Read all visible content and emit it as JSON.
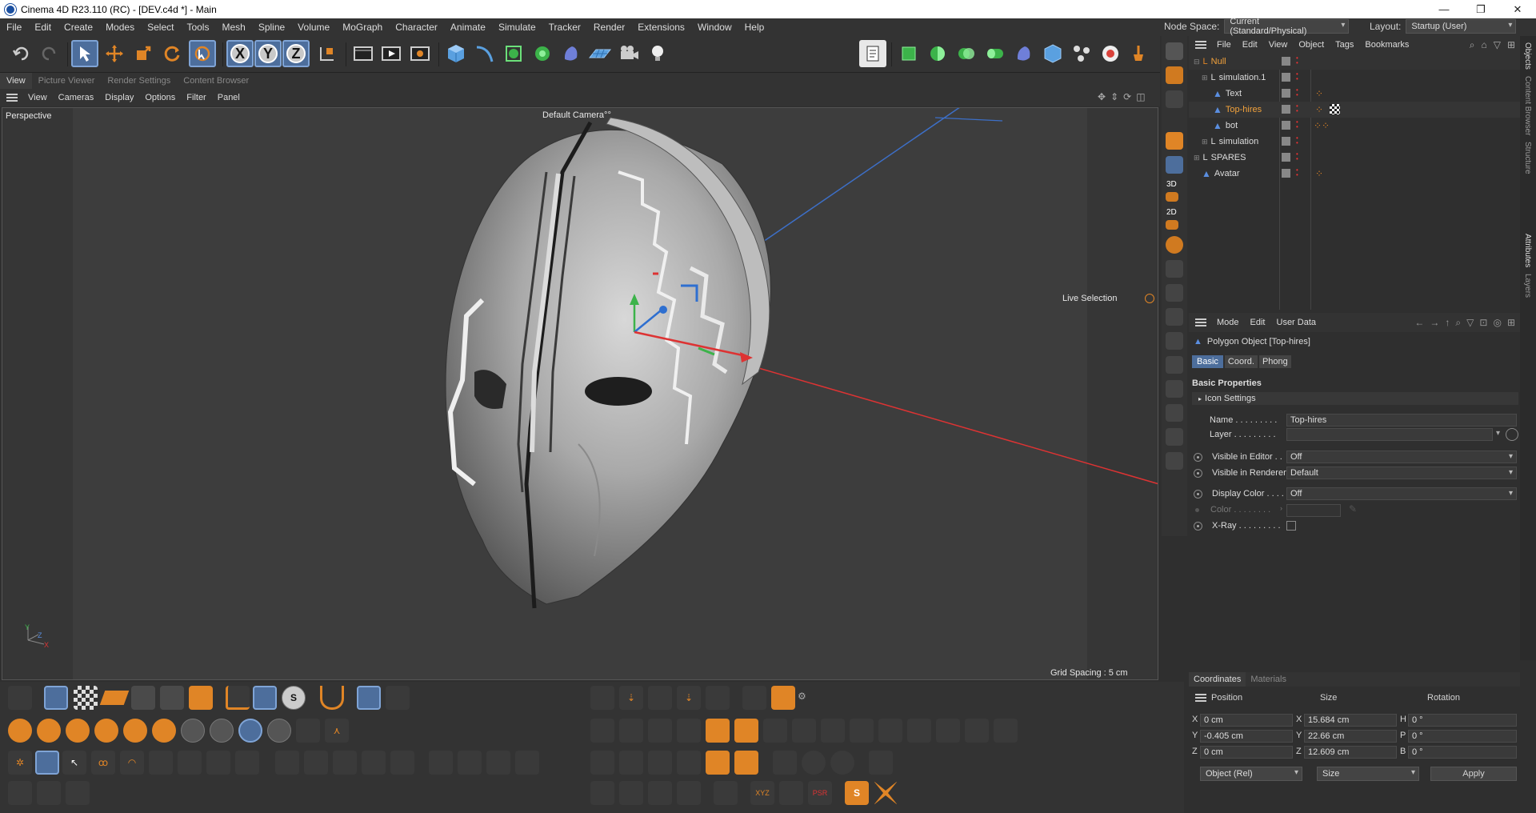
{
  "window": {
    "title": "Cinema 4D R23.110 (RC) - [DEV.c4d *] - Main",
    "minimize": "—",
    "restore": "❐",
    "close": "✕"
  },
  "menu": [
    "File",
    "Edit",
    "Create",
    "Modes",
    "Select",
    "Tools",
    "Mesh",
    "Spline",
    "Volume",
    "MoGraph",
    "Character",
    "Animate",
    "Simulate",
    "Tracker",
    "Render",
    "Extensions",
    "Window",
    "Help"
  ],
  "node_space": {
    "label": "Node Space:",
    "value": "Current (Standard/Physical)"
  },
  "layout": {
    "label": "Layout:",
    "value": "Startup (User)"
  },
  "toolbar": {
    "x_label": "X",
    "y_label": "Y",
    "z_label": "Z"
  },
  "view_tabs": [
    "View",
    "Picture Viewer",
    "Render Settings",
    "Content Browser"
  ],
  "view_menu": [
    "View",
    "Cameras",
    "Display",
    "Options",
    "Filter",
    "Panel"
  ],
  "viewport": {
    "projection": "Perspective",
    "camera": "Default Camera",
    "camera_suffix": "°°",
    "tool": "Live Selection",
    "grid_spacing": "Grid Spacing : 5 cm",
    "axis_y": "Y",
    "axis_z": "Z",
    "axis_x": "X"
  },
  "strip_labels": {
    "threed": "3D",
    "twod": "2D"
  },
  "object_manager": {
    "menu": [
      "File",
      "Edit",
      "View",
      "Object",
      "Tags",
      "Bookmarks"
    ],
    "objects": [
      {
        "name": "Null",
        "color": "#f2a23c"
      },
      {
        "name": "simulation.1",
        "color": "#dddddd"
      },
      {
        "name": "Text",
        "color": "#dddddd"
      },
      {
        "name": "Top-hires",
        "color": "#f2a23c"
      },
      {
        "name": "bot",
        "color": "#dddddd"
      },
      {
        "name": "simulation",
        "color": "#dddddd"
      },
      {
        "name": "SPARES",
        "color": "#dddddd"
      },
      {
        "name": "Avatar",
        "color": "#dddddd"
      }
    ]
  },
  "side_tabs": {
    "top": [
      "Objects",
      "Content Browser",
      "Structure"
    ],
    "mid": [
      "Attributes",
      "Layers"
    ]
  },
  "attributes": {
    "menu": [
      "Mode",
      "Edit",
      "User Data"
    ],
    "object_title": "Polygon Object [Top-hires]",
    "tabs": [
      "Basic",
      "Coord.",
      "Phong"
    ],
    "section": "Basic Properties",
    "icon_settings": "Icon Settings",
    "name_label": "Name . . . . . . . . .",
    "name_value": "Top-hires",
    "layer_label": "Layer . . . . . . . . .",
    "visible_editor_label": "Visible in Editor . .",
    "visible_editor_value": "Off",
    "visible_renderer_label": "Visible in Renderer",
    "visible_renderer_value": "Default",
    "display_color_label": "Display Color . . . .",
    "display_color_value": "Off",
    "color_label": "Color . . . . . . . .",
    "xray_label": "X-Ray . . . . . . . . ."
  },
  "coordinates": {
    "tabs": [
      "Coordinates",
      "Materials"
    ],
    "headers": [
      "Position",
      "Size",
      "Rotation"
    ],
    "rows": [
      {
        "axis": "X",
        "pos": "0 cm",
        "size_axis": "X",
        "size": "15.684 cm",
        "rot_axis": "H",
        "rot": "0 °"
      },
      {
        "axis": "Y",
        "pos": "-0.405 cm",
        "size_axis": "Y",
        "size": "22.66 cm",
        "rot_axis": "P",
        "rot": "0 °"
      },
      {
        "axis": "Z",
        "pos": "0 cm",
        "size_axis": "Z",
        "size": "12.609 cm",
        "rot_axis": "B",
        "rot": "0 °"
      }
    ],
    "mode": "Object (Rel)",
    "size_mode": "Size",
    "apply": "Apply"
  },
  "colors": {
    "accent": "#e08526",
    "selected": "#4d6e9c",
    "bg": "#2f2f2f"
  }
}
